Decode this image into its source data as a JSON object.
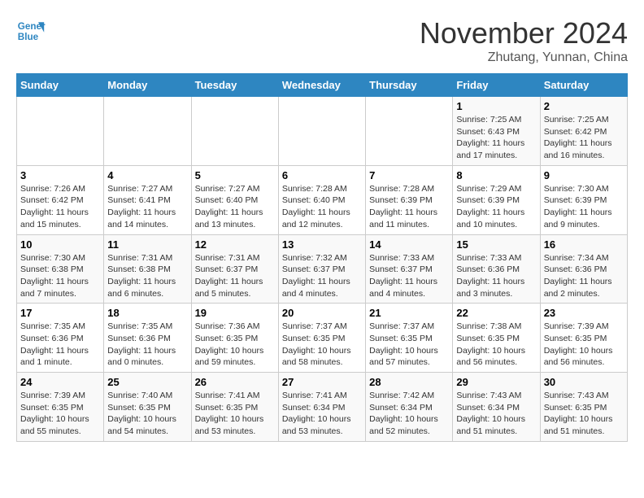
{
  "header": {
    "logo_line1": "General",
    "logo_line2": "Blue",
    "month": "November 2024",
    "location": "Zhutang, Yunnan, China"
  },
  "weekdays": [
    "Sunday",
    "Monday",
    "Tuesday",
    "Wednesday",
    "Thursday",
    "Friday",
    "Saturday"
  ],
  "weeks": [
    [
      {
        "day": "",
        "info": ""
      },
      {
        "day": "",
        "info": ""
      },
      {
        "day": "",
        "info": ""
      },
      {
        "day": "",
        "info": ""
      },
      {
        "day": "",
        "info": ""
      },
      {
        "day": "1",
        "info": "Sunrise: 7:25 AM\nSunset: 6:43 PM\nDaylight: 11 hours and 17 minutes."
      },
      {
        "day": "2",
        "info": "Sunrise: 7:25 AM\nSunset: 6:42 PM\nDaylight: 11 hours and 16 minutes."
      }
    ],
    [
      {
        "day": "3",
        "info": "Sunrise: 7:26 AM\nSunset: 6:42 PM\nDaylight: 11 hours and 15 minutes."
      },
      {
        "day": "4",
        "info": "Sunrise: 7:27 AM\nSunset: 6:41 PM\nDaylight: 11 hours and 14 minutes."
      },
      {
        "day": "5",
        "info": "Sunrise: 7:27 AM\nSunset: 6:40 PM\nDaylight: 11 hours and 13 minutes."
      },
      {
        "day": "6",
        "info": "Sunrise: 7:28 AM\nSunset: 6:40 PM\nDaylight: 11 hours and 12 minutes."
      },
      {
        "day": "7",
        "info": "Sunrise: 7:28 AM\nSunset: 6:39 PM\nDaylight: 11 hours and 11 minutes."
      },
      {
        "day": "8",
        "info": "Sunrise: 7:29 AM\nSunset: 6:39 PM\nDaylight: 11 hours and 10 minutes."
      },
      {
        "day": "9",
        "info": "Sunrise: 7:30 AM\nSunset: 6:39 PM\nDaylight: 11 hours and 9 minutes."
      }
    ],
    [
      {
        "day": "10",
        "info": "Sunrise: 7:30 AM\nSunset: 6:38 PM\nDaylight: 11 hours and 7 minutes."
      },
      {
        "day": "11",
        "info": "Sunrise: 7:31 AM\nSunset: 6:38 PM\nDaylight: 11 hours and 6 minutes."
      },
      {
        "day": "12",
        "info": "Sunrise: 7:31 AM\nSunset: 6:37 PM\nDaylight: 11 hours and 5 minutes."
      },
      {
        "day": "13",
        "info": "Sunrise: 7:32 AM\nSunset: 6:37 PM\nDaylight: 11 hours and 4 minutes."
      },
      {
        "day": "14",
        "info": "Sunrise: 7:33 AM\nSunset: 6:37 PM\nDaylight: 11 hours and 4 minutes."
      },
      {
        "day": "15",
        "info": "Sunrise: 7:33 AM\nSunset: 6:36 PM\nDaylight: 11 hours and 3 minutes."
      },
      {
        "day": "16",
        "info": "Sunrise: 7:34 AM\nSunset: 6:36 PM\nDaylight: 11 hours and 2 minutes."
      }
    ],
    [
      {
        "day": "17",
        "info": "Sunrise: 7:35 AM\nSunset: 6:36 PM\nDaylight: 11 hours and 1 minute."
      },
      {
        "day": "18",
        "info": "Sunrise: 7:35 AM\nSunset: 6:36 PM\nDaylight: 11 hours and 0 minutes."
      },
      {
        "day": "19",
        "info": "Sunrise: 7:36 AM\nSunset: 6:35 PM\nDaylight: 10 hours and 59 minutes."
      },
      {
        "day": "20",
        "info": "Sunrise: 7:37 AM\nSunset: 6:35 PM\nDaylight: 10 hours and 58 minutes."
      },
      {
        "day": "21",
        "info": "Sunrise: 7:37 AM\nSunset: 6:35 PM\nDaylight: 10 hours and 57 minutes."
      },
      {
        "day": "22",
        "info": "Sunrise: 7:38 AM\nSunset: 6:35 PM\nDaylight: 10 hours and 56 minutes."
      },
      {
        "day": "23",
        "info": "Sunrise: 7:39 AM\nSunset: 6:35 PM\nDaylight: 10 hours and 56 minutes."
      }
    ],
    [
      {
        "day": "24",
        "info": "Sunrise: 7:39 AM\nSunset: 6:35 PM\nDaylight: 10 hours and 55 minutes."
      },
      {
        "day": "25",
        "info": "Sunrise: 7:40 AM\nSunset: 6:35 PM\nDaylight: 10 hours and 54 minutes."
      },
      {
        "day": "26",
        "info": "Sunrise: 7:41 AM\nSunset: 6:35 PM\nDaylight: 10 hours and 53 minutes."
      },
      {
        "day": "27",
        "info": "Sunrise: 7:41 AM\nSunset: 6:34 PM\nDaylight: 10 hours and 53 minutes."
      },
      {
        "day": "28",
        "info": "Sunrise: 7:42 AM\nSunset: 6:34 PM\nDaylight: 10 hours and 52 minutes."
      },
      {
        "day": "29",
        "info": "Sunrise: 7:43 AM\nSunset: 6:34 PM\nDaylight: 10 hours and 51 minutes."
      },
      {
        "day": "30",
        "info": "Sunrise: 7:43 AM\nSunset: 6:35 PM\nDaylight: 10 hours and 51 minutes."
      }
    ]
  ]
}
